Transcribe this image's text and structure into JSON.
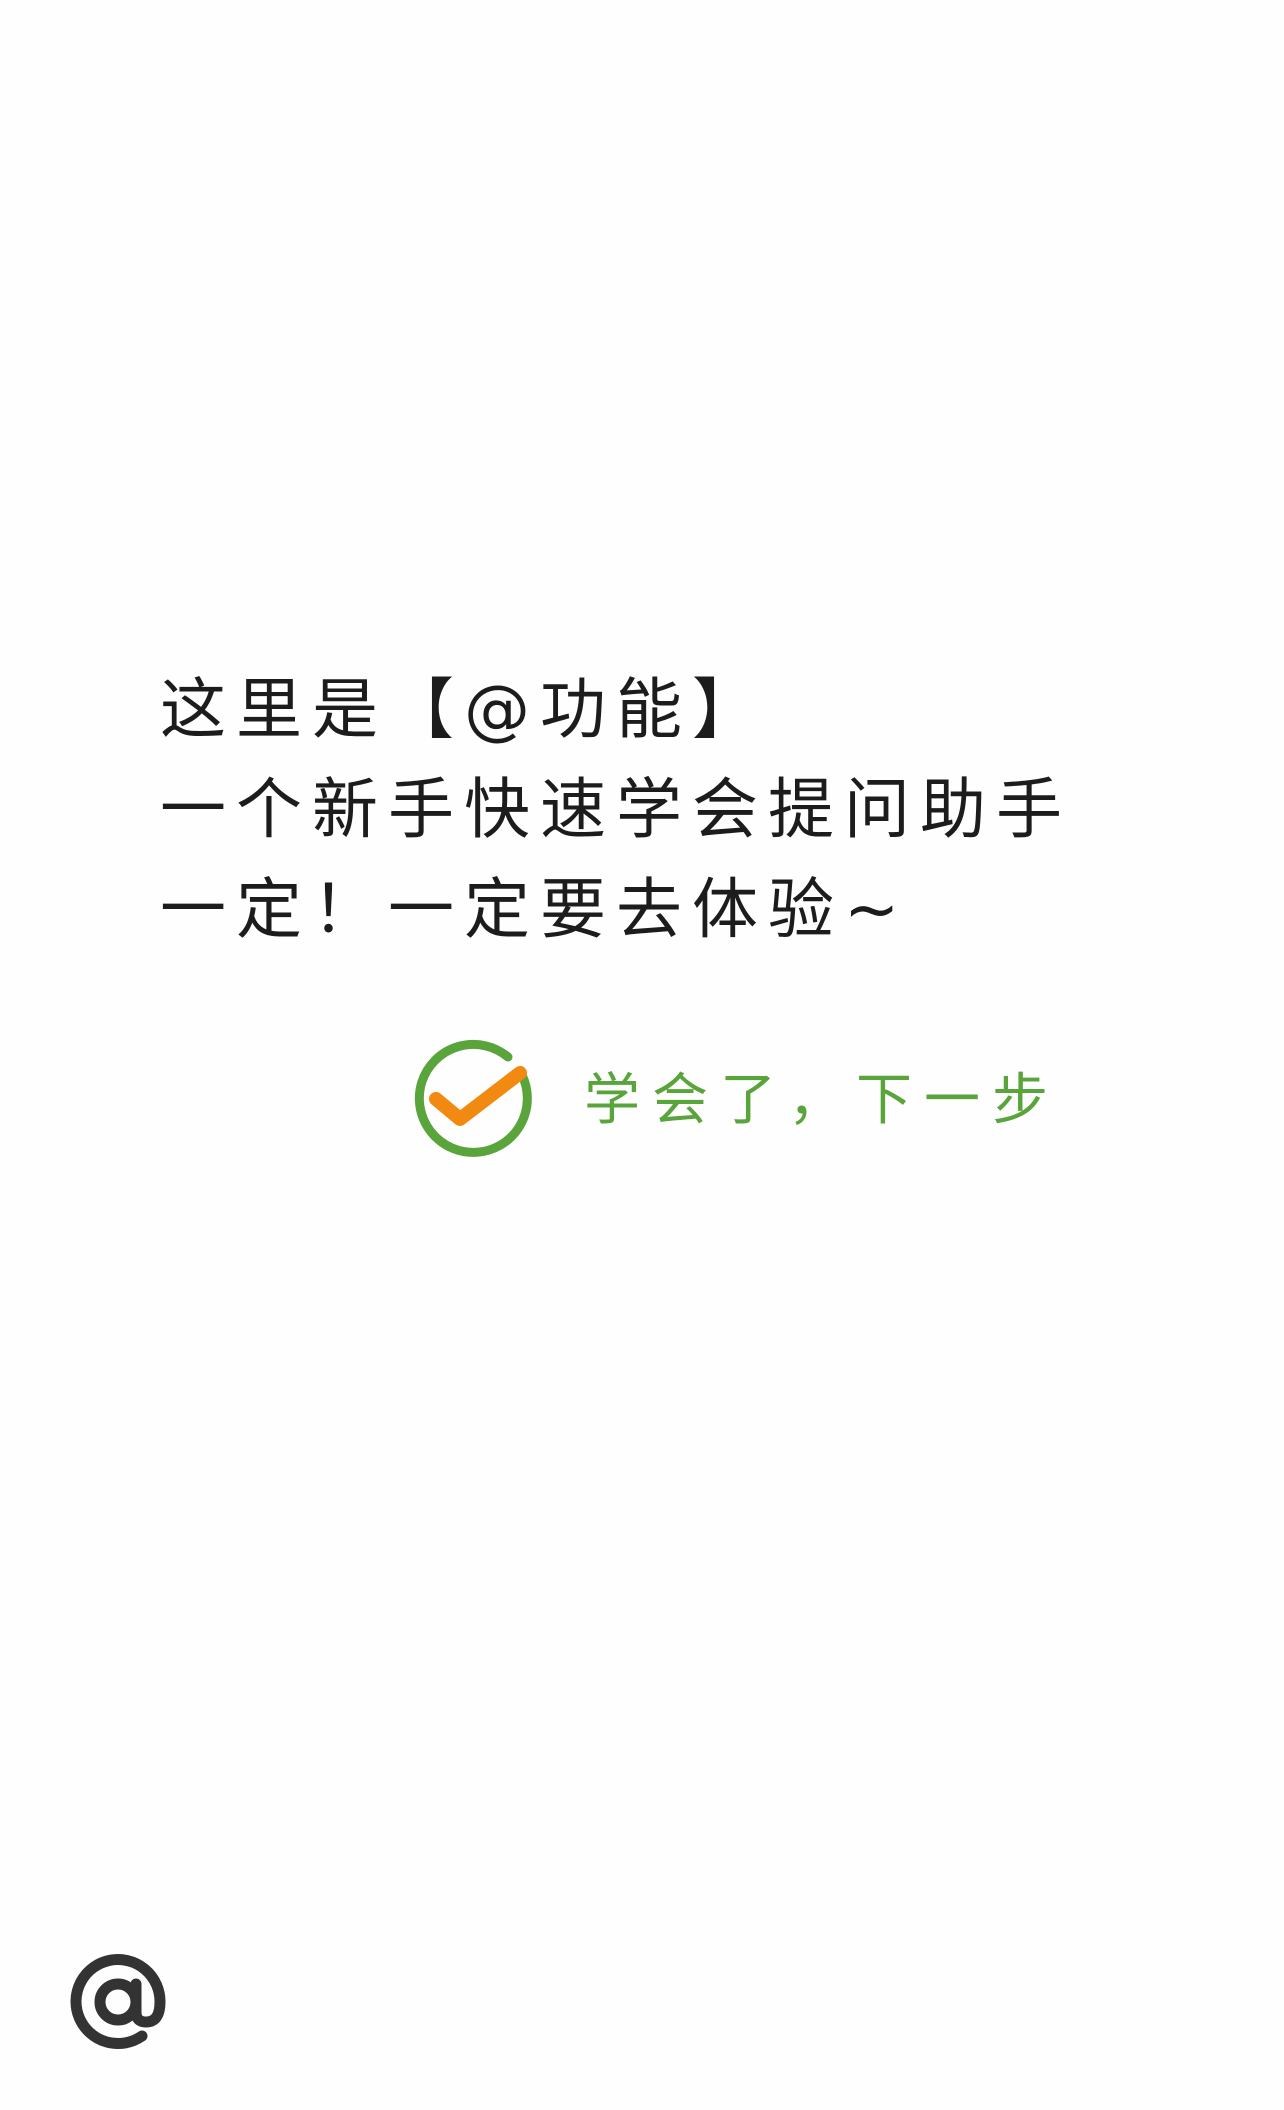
{
  "guide": {
    "lines": [
      "这里是【@功能】",
      "一个新手快速学会提问助手",
      "一定！一定要去体验~"
    ]
  },
  "next_step": {
    "label": "学会了，下一步",
    "icon": "check-circle-icon"
  },
  "at_button": {
    "icon": "at-sign-icon"
  },
  "colors": {
    "background": "#fefefe",
    "text": "#1c1c1c",
    "accent_green": "#5aa43c",
    "accent_orange": "#f28a12",
    "icon_gray": "#333333"
  }
}
